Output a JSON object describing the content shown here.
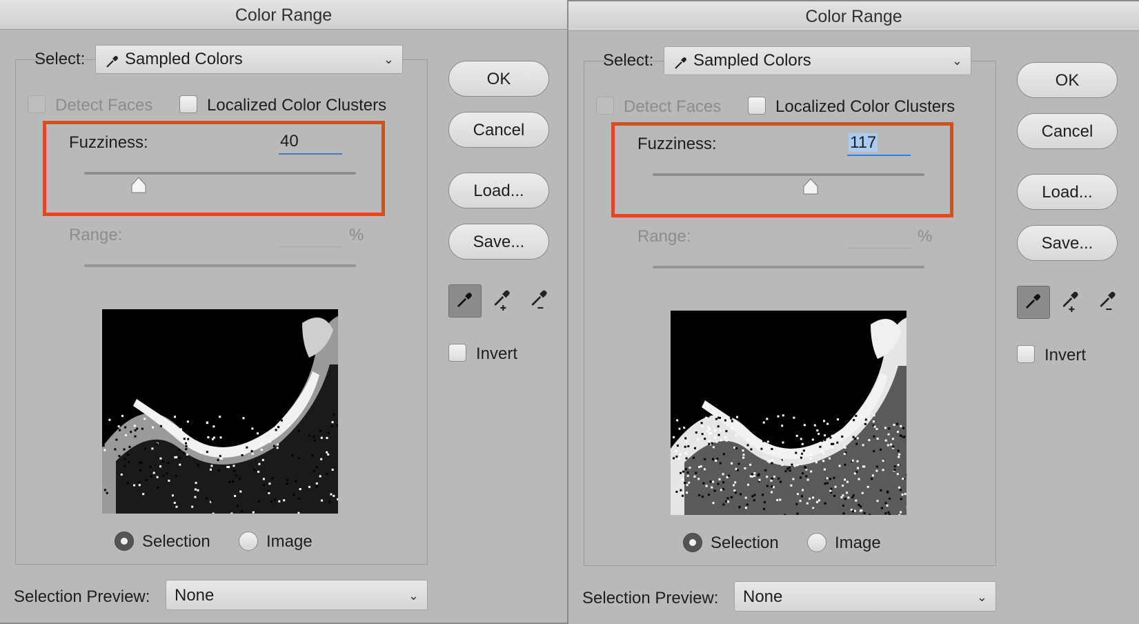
{
  "dialogs": [
    {
      "title": "Color Range",
      "select_label": "Select:",
      "select_value": "Sampled Colors",
      "detect_faces_label": "Detect Faces",
      "localized_label": "Localized Color Clusters",
      "fuzziness_label": "Fuzziness:",
      "fuzziness_value": "40",
      "fuzziness_level": 0.2,
      "range_label": "Range:",
      "range_unit": "%",
      "buttons": {
        "ok": "OK",
        "cancel": "Cancel",
        "load": "Load...",
        "save": "Save..."
      },
      "invert_label": "Invert",
      "radio_selection": "Selection",
      "radio_image": "Image",
      "selection_preview_label": "Selection Preview:",
      "selection_preview_value": "None"
    },
    {
      "title": "Color Range",
      "select_label": "Select:",
      "select_value": "Sampled Colors",
      "detect_faces_label": "Detect Faces",
      "localized_label": "Localized Color Clusters",
      "fuzziness_label": "Fuzziness:",
      "fuzziness_value": "117",
      "fuzziness_level": 0.58,
      "range_label": "Range:",
      "range_unit": "%",
      "buttons": {
        "ok": "OK",
        "cancel": "Cancel",
        "load": "Load...",
        "save": "Save..."
      },
      "invert_label": "Invert",
      "radio_selection": "Selection",
      "radio_image": "Image",
      "selection_preview_label": "Selection Preview:",
      "selection_preview_value": "None"
    }
  ],
  "colors": {
    "highlight": "#e04a1a",
    "dialog_bg": "#b9b9b9",
    "field_underline": "#3d7ad6"
  },
  "icons": [
    "eyedropper-icon",
    "eyedropper-plus-icon",
    "eyedropper-minus-icon",
    "chevron-down-icon"
  ]
}
